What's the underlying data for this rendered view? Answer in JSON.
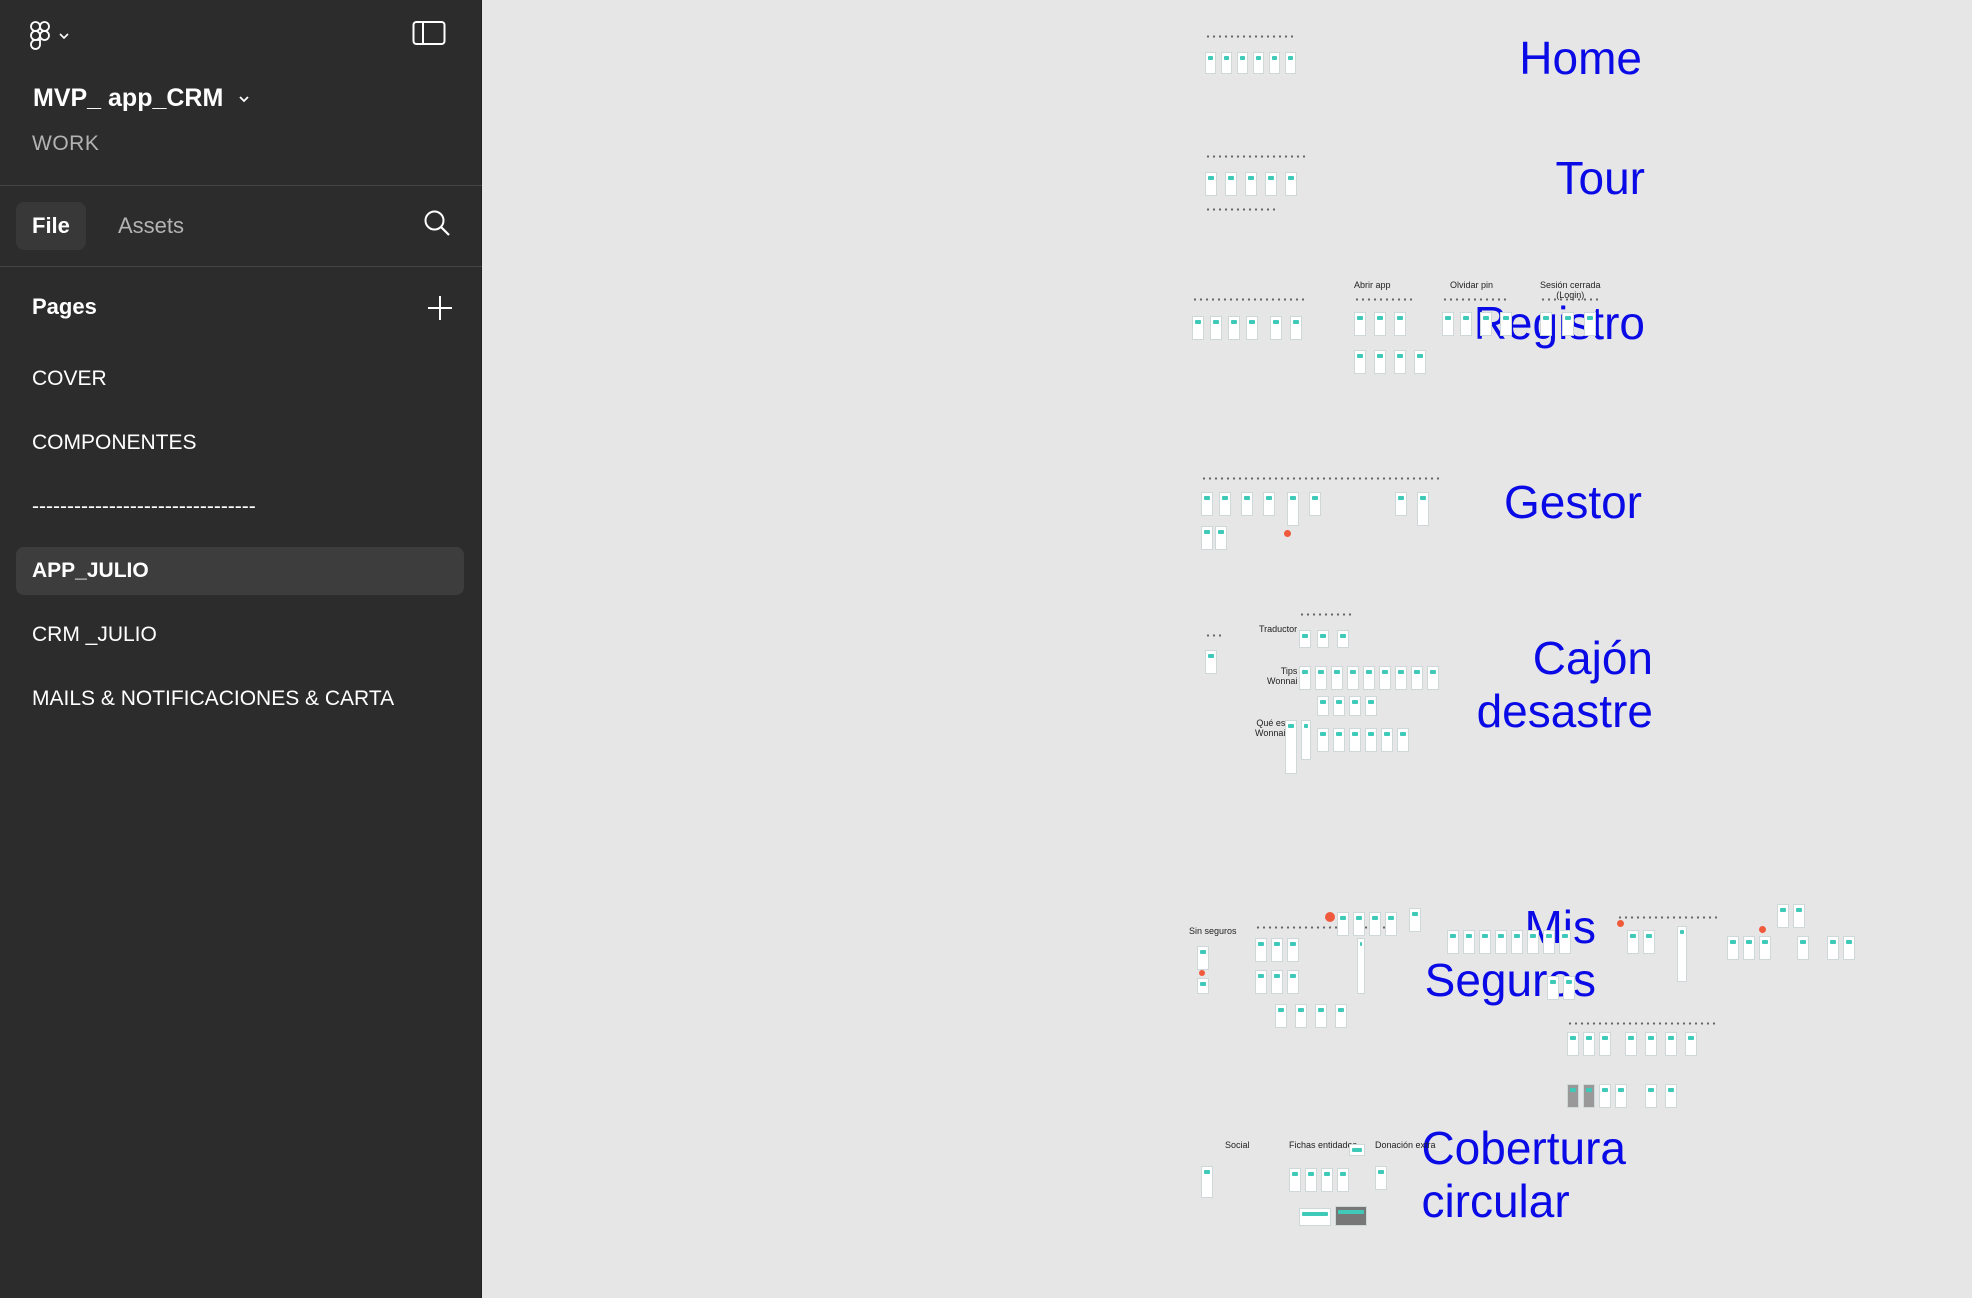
{
  "project": {
    "name": "MVP_ app_CRM",
    "team": "WORK"
  },
  "tabs": {
    "file": "File",
    "assets": "Assets"
  },
  "pages": {
    "header": "Pages",
    "items": [
      {
        "label": "COVER"
      },
      {
        "label": "COMPONENTES"
      },
      {
        "label": "--------------------------------"
      },
      {
        "label": "APP_JULIO",
        "active": true
      },
      {
        "label": "CRM _JULIO"
      },
      {
        "label": "MAILS & NOTIFICACIONES & CARTA"
      }
    ]
  },
  "canvas": {
    "sections": [
      {
        "label": "Home"
      },
      {
        "label": "Tour"
      },
      {
        "label": "Registro"
      },
      {
        "label": "Gestor"
      },
      {
        "label": "Cajón\ndesastre"
      },
      {
        "label": "Mis\nSeguros"
      },
      {
        "label": "Cobertura\ncircular"
      }
    ],
    "sublabels": {
      "abrir_app": "Abrir app",
      "olvidar_pin": "Olvidar pin",
      "sesion_cerrada": "Sesión cerrada\n(Login)",
      "traductor": "Traductor",
      "tips": "Tips\nWonnai",
      "que_es": "Qué es\nWonnai",
      "sin_seguros": "Sin seguros",
      "social": "Social",
      "fichas": "Fichas entidades",
      "donacion": "Donación extra"
    }
  },
  "colors": {
    "sidebar_bg": "#2c2c2c",
    "canvas_bg": "#e6e6e6",
    "section_label": "#0a0ae6",
    "frame_accent": "#3ec9b8"
  },
  "icons": {
    "logo": "figma-logo-icon",
    "menu": "chevron-down-icon",
    "panel": "sidebar-toggle-icon",
    "search": "search-icon",
    "add": "plus-icon"
  }
}
